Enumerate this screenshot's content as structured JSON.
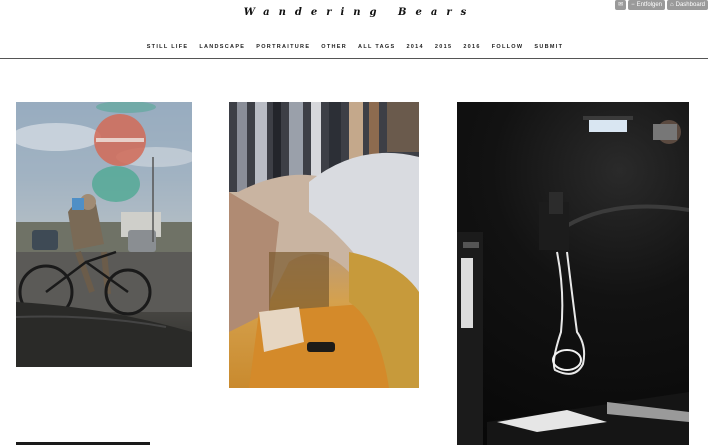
{
  "blog": {
    "title": "Wandering Bears"
  },
  "controls": {
    "unfollow_label": "Entfolgen",
    "dashboard_label": "Dashboard"
  },
  "nav": {
    "items": [
      "STILL LIFE",
      "LANDSCAPE",
      "PORTRAITURE",
      "OTHER",
      "ALL TAGS",
      "2014",
      "2015",
      "2016",
      "FOLLOW",
      "SUBMIT"
    ]
  },
  "colors": {
    "background": "#ffffff",
    "text": "#111111",
    "control_bg": "#9a9a9a"
  },
  "icons": {
    "mail": "mail-icon",
    "unfollow": "minus-icon",
    "dashboard": "home-icon"
  }
}
